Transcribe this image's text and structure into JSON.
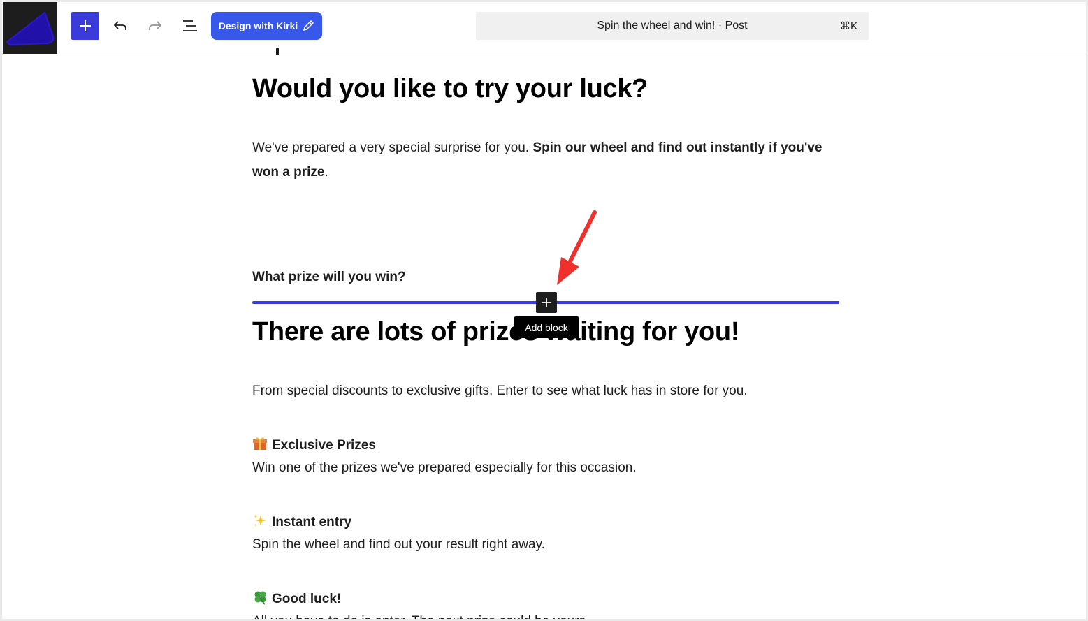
{
  "toolbar": {
    "kirki_label": "Design with Kirki",
    "command_title": "Spin the wheel and win! · Post",
    "command_shortcut": "⌘K",
    "brand_color": "#3858e9",
    "inserter_color": "#3b3bd9"
  },
  "content": {
    "heading1": "Would you like to try your luck?",
    "intro_plain": "We've prepared a very special surprise for you. ",
    "intro_bold": "Spin our wheel and find out instantly if you've won a prize",
    "intro_end": ".",
    "prize_question": "What prize will you win?",
    "heading2": "There are lots of prizes waiting for you!",
    "description": "From special discounts to exclusive gifts. Enter to see what luck has in store for you.",
    "features": [
      {
        "icon": "gift-icon",
        "title": "Exclusive Prizes",
        "text": "Win one of the prizes we've prepared especially for this occasion."
      },
      {
        "icon": "sparkles-icon",
        "title": "Instant entry",
        "text": "Spin the wheel and find out your result right away."
      },
      {
        "icon": "clover-icon",
        "title": "Good luck!",
        "text": "All you have to do is enter. The next prize could be yours."
      }
    ]
  },
  "block_inserter": {
    "tooltip": "Add block",
    "separator_color": "#3b3bd9"
  },
  "annotation": {
    "arrow_color": "#f0302c"
  }
}
